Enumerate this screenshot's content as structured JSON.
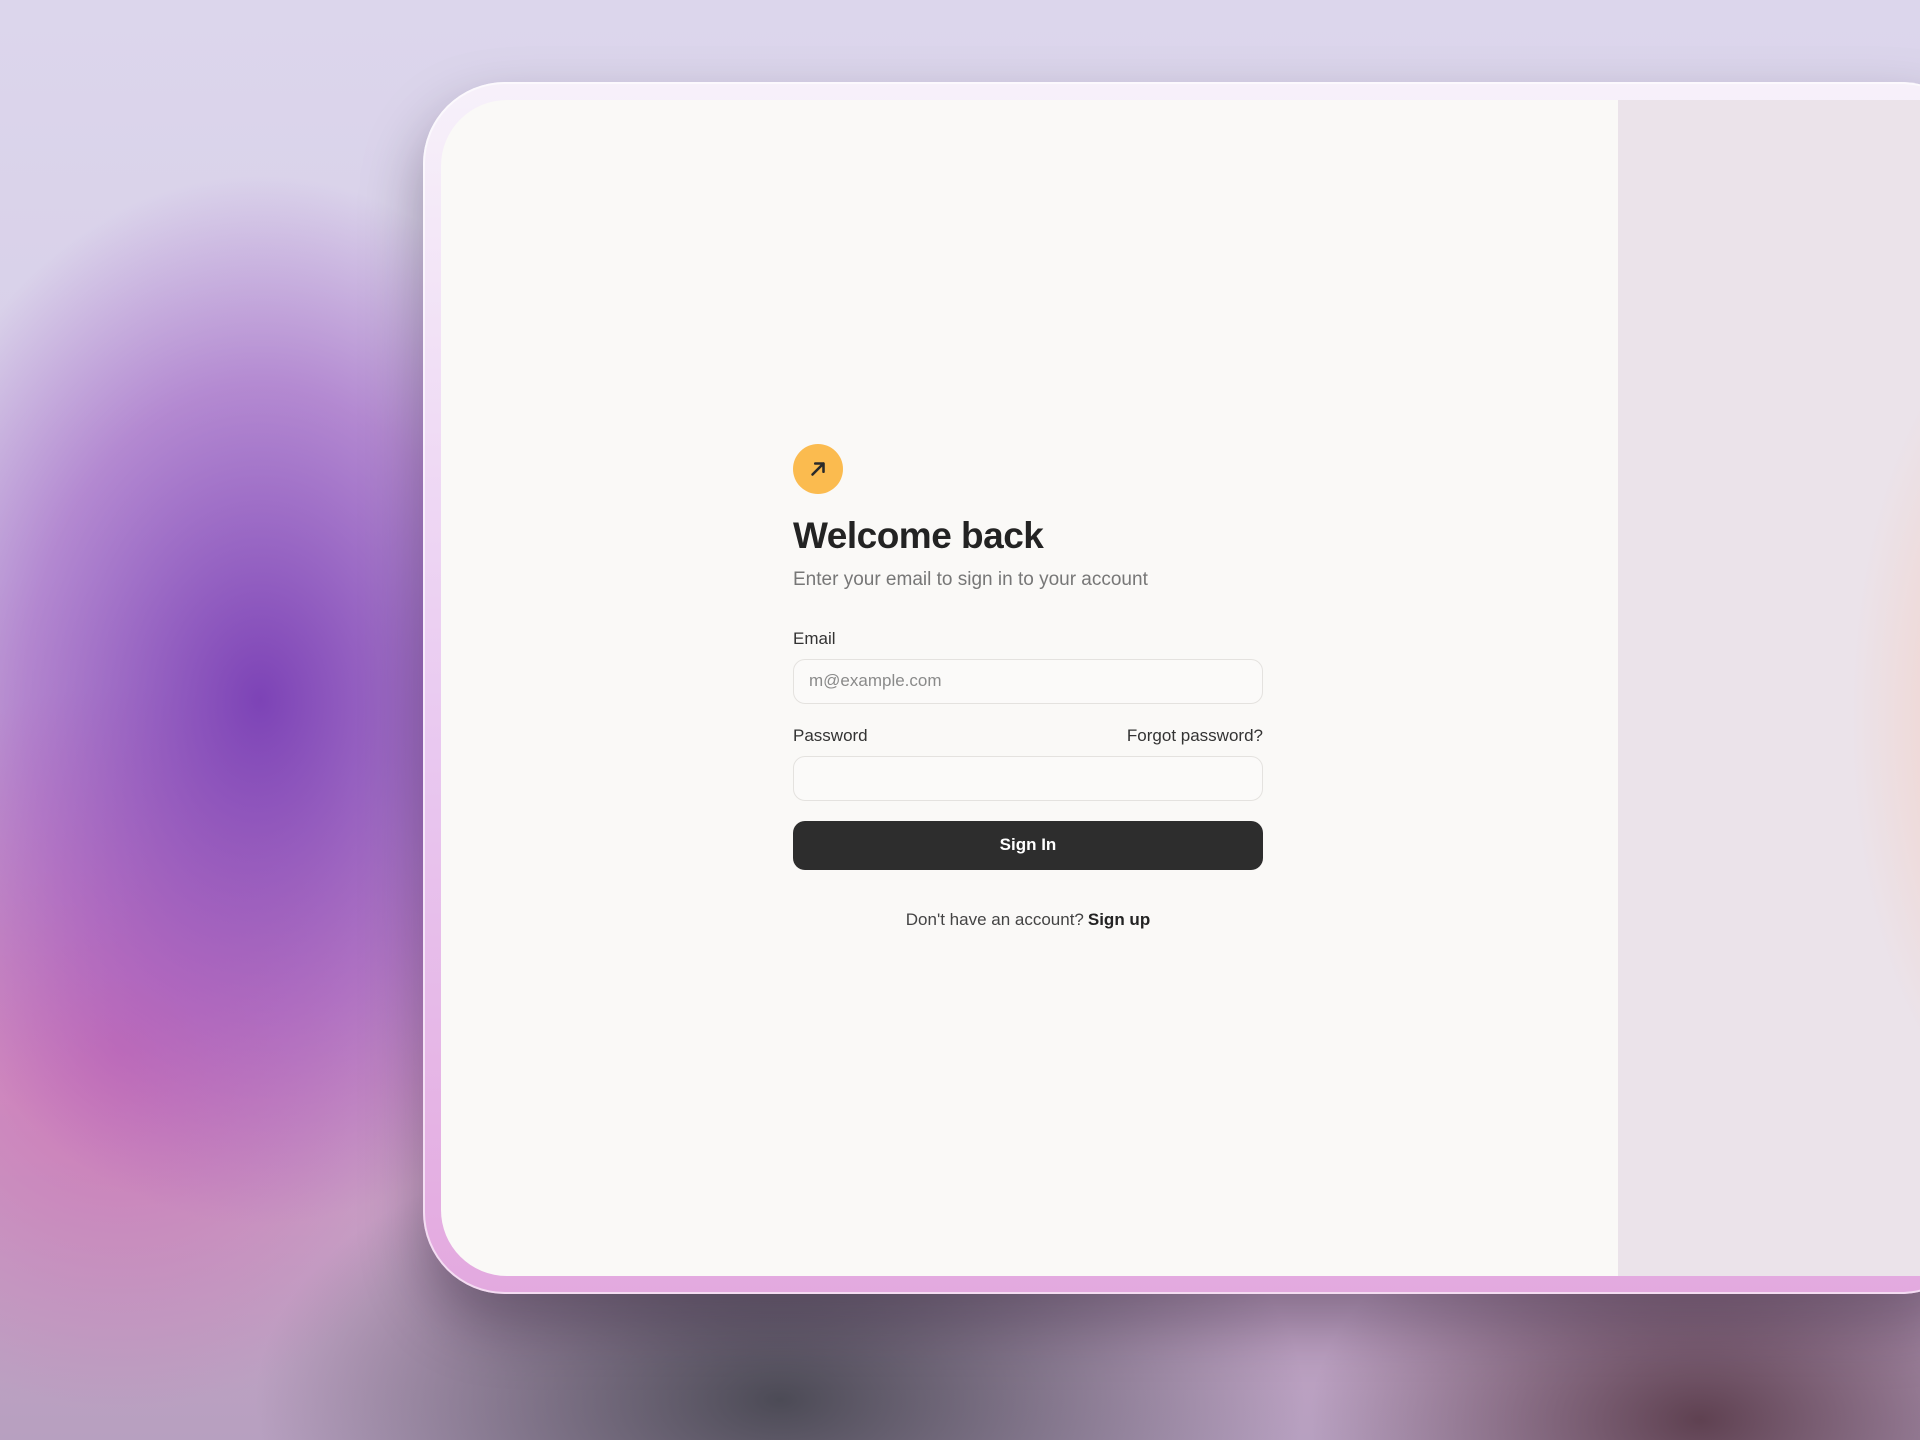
{
  "login": {
    "logo_icon": "arrow-up-right-icon",
    "accent_color": "#fbbb4f",
    "title": "Welcome back",
    "subtitle": "Enter your email to sign in to your account",
    "email_label": "Email",
    "email_placeholder": "m@example.com",
    "email_value": "",
    "password_label": "Password",
    "forgot_password": "Forgot password?",
    "password_value": "",
    "sign_in_button": "Sign In",
    "signup_prompt": "Don't have an account?",
    "signup_link": "Sign up"
  }
}
